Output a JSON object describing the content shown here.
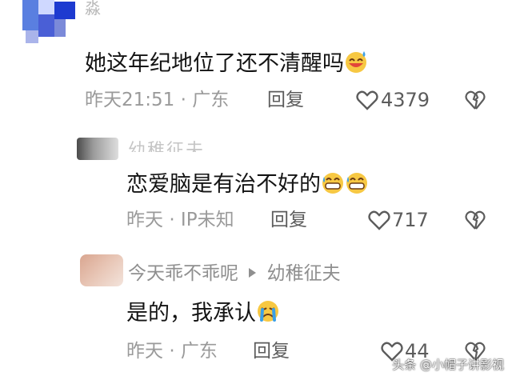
{
  "comments": [
    {
      "username": "淼",
      "text": "她这年纪地位了还不清醒吗",
      "emoji": [
        "sweat-smile-face"
      ],
      "time": "昨天21:51",
      "location": "· 广东",
      "reply_label": "回复",
      "likes": "4379"
    },
    {
      "username": "幼稚征夫",
      "text": "恋爱脑是有治不好的",
      "emoji": [
        "grin-sweat-face",
        "grin-sweat-face"
      ],
      "time": "昨天",
      "location": "· IP未知",
      "reply_label": "回复",
      "likes": "717"
    },
    {
      "username": "今天乖不乖呢",
      "reply_to": "幼稚征夫",
      "text": "是的，我承认",
      "emoji": [
        "crying-face"
      ],
      "time": "昨天",
      "location": "· 广东",
      "reply_label": "回复",
      "likes": "44"
    }
  ],
  "watermark": "头条 @小帽子讲影视",
  "colors": {
    "text_primary": "#141414",
    "text_meta": "#9a9a9a",
    "text_action": "#5c5c5c",
    "emoji_yellow": "#f7c843",
    "emoji_blue": "#3aa0e8"
  }
}
